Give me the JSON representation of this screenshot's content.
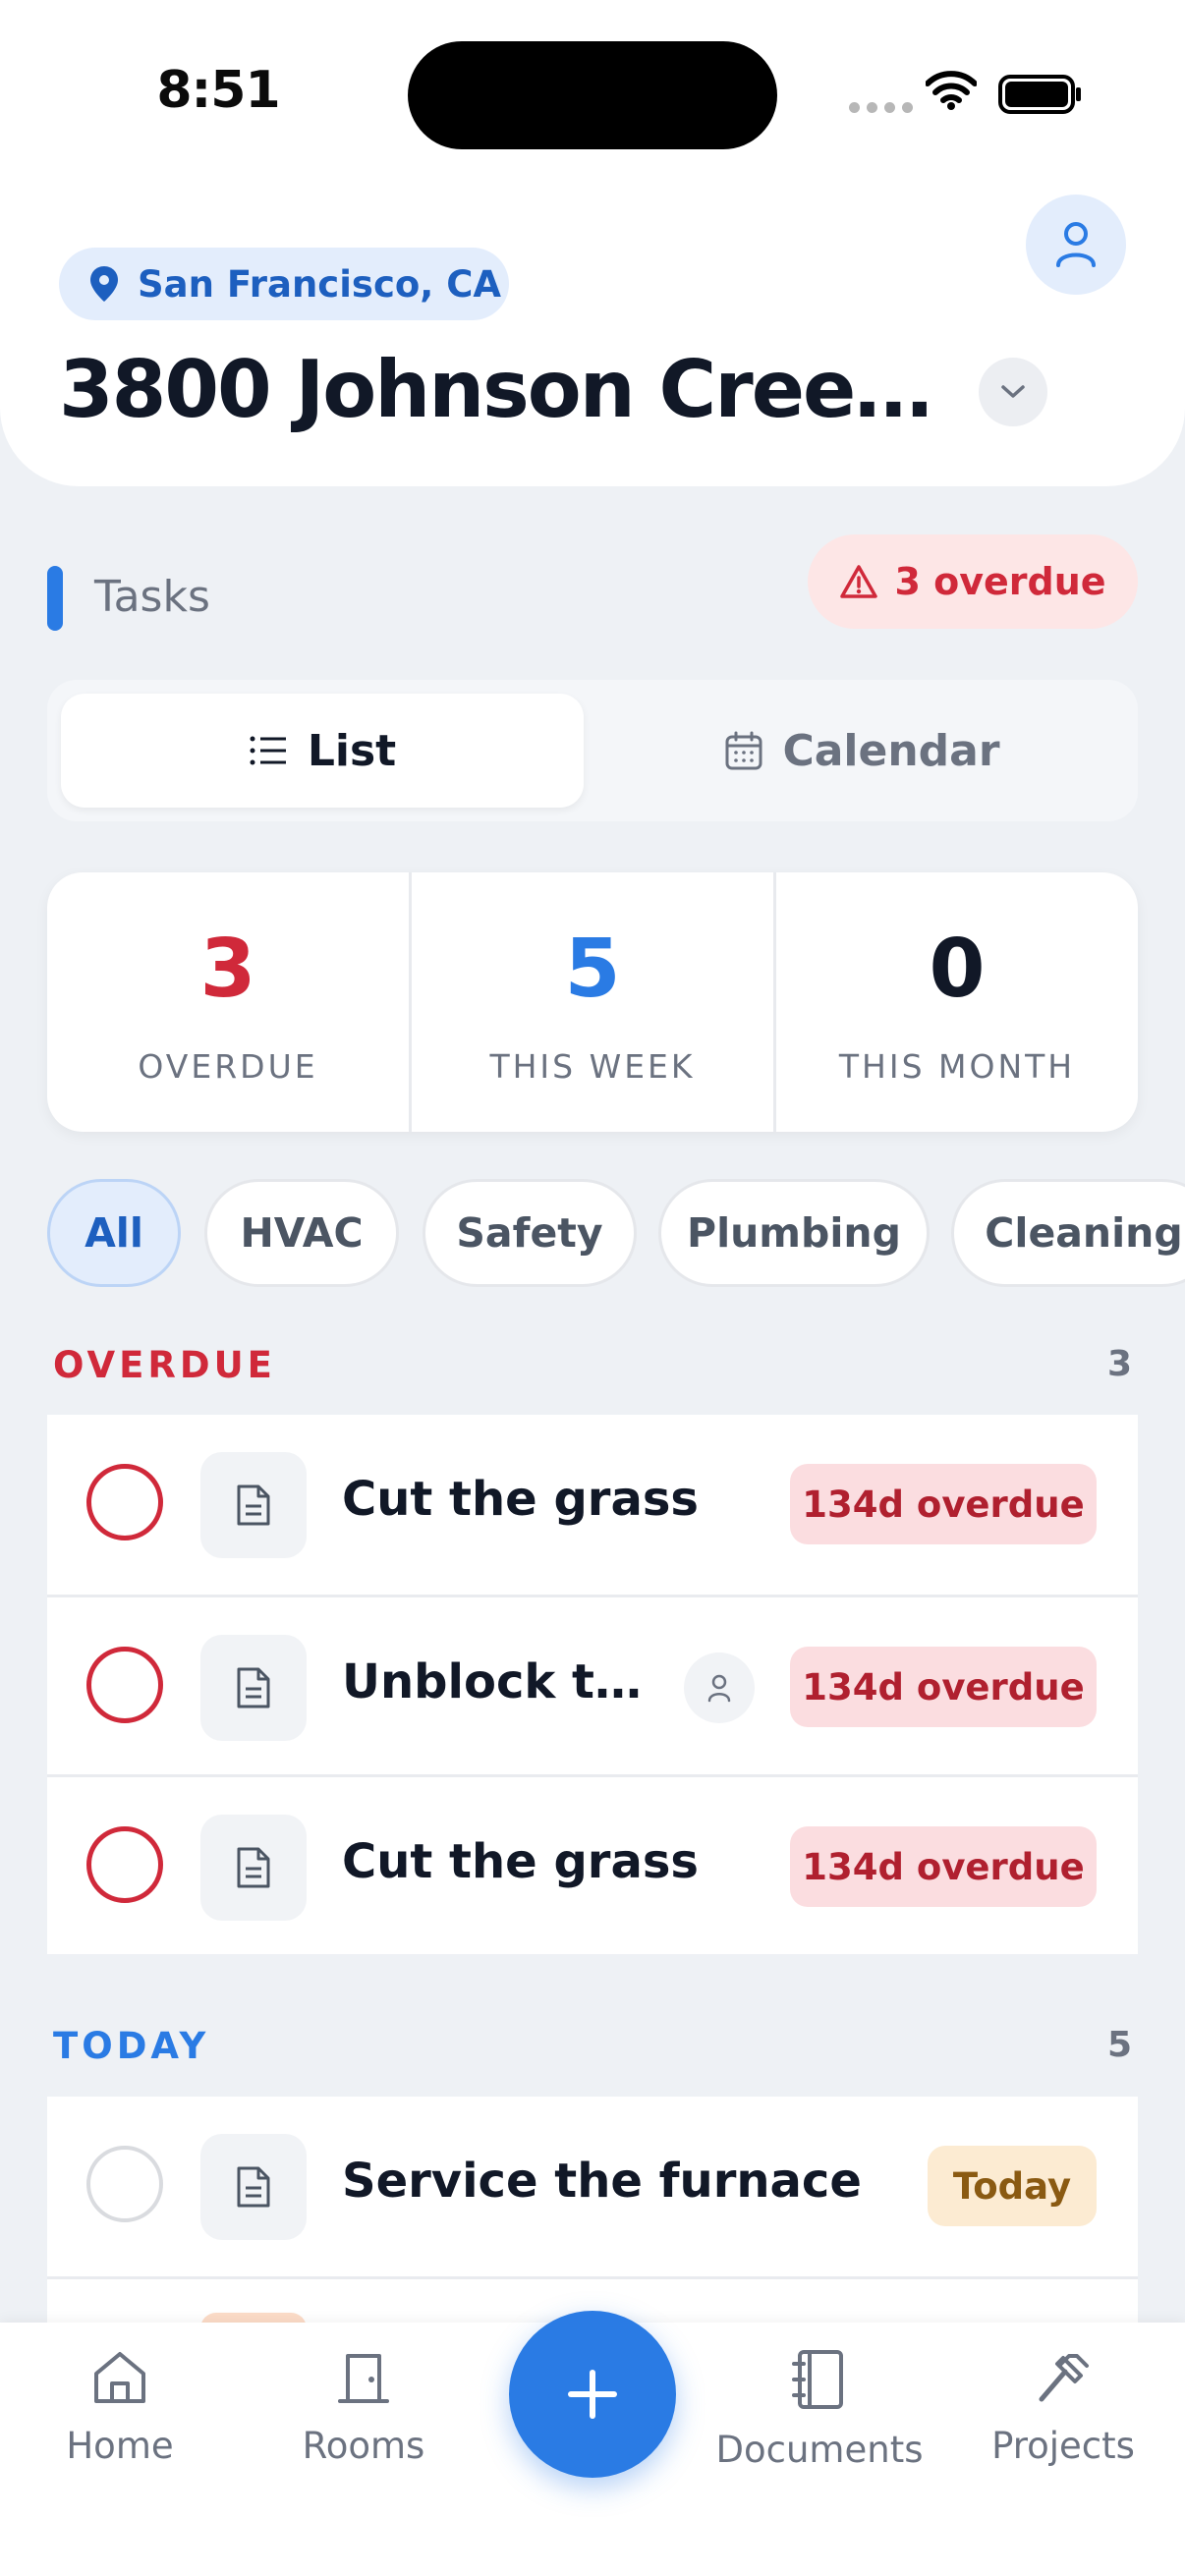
{
  "status_bar": {
    "time": "8:51"
  },
  "header": {
    "location": "San Francisco, CA",
    "address": "3800 Johnson Creek..."
  },
  "tasks_section": {
    "label": "Tasks",
    "overdue_pill": "3 overdue"
  },
  "view_toggle": {
    "list_label": "List",
    "calendar_label": "Calendar",
    "selected": "List"
  },
  "stats": [
    {
      "value": "3",
      "caption": "OVERDUE",
      "color": "#d0293a"
    },
    {
      "value": "5",
      "caption": "THIS WEEK",
      "color": "#2a7be4"
    },
    {
      "value": "0",
      "caption": "THIS MONTH",
      "color": "#111827"
    }
  ],
  "filters": {
    "items": [
      "All",
      "HVAC",
      "Safety",
      "Plumbing",
      "Cleaning"
    ],
    "selected": "All"
  },
  "groups": {
    "overdue": {
      "title": "OVERDUE",
      "count": "3",
      "tasks": [
        {
          "title": "Cut the grass",
          "badge": "134d overdue"
        },
        {
          "title": "Unblock th...",
          "badge": "134d overdue",
          "assigned": true
        },
        {
          "title": "Cut the grass",
          "badge": "134d overdue"
        }
      ]
    },
    "today": {
      "title": "TODAY",
      "count": "5",
      "tasks": [
        {
          "title": "Service the furnace",
          "badge": "Today"
        }
      ]
    }
  },
  "bottom_nav": {
    "items": [
      "Home",
      "Rooms",
      "Documents",
      "Projects"
    ],
    "fab_icon": "plus-icon"
  },
  "colors": {
    "accent": "#2a7be4",
    "danger": "#d0293a",
    "background": "#eef1f5"
  }
}
